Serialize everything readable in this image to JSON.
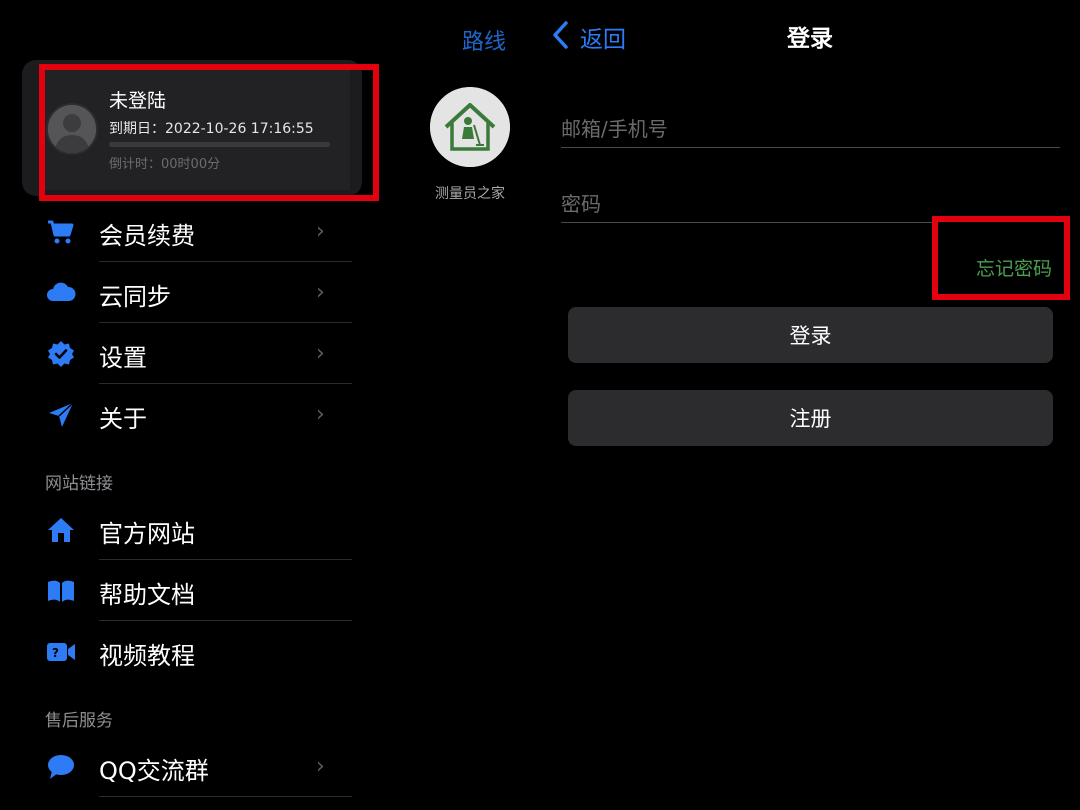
{
  "profile": {
    "name": "未登陆",
    "expiry": "到期日：2022-10-26 17:16:55",
    "countdown": "倒计时：00时00分"
  },
  "menu": {
    "items": [
      {
        "label": "会员续费",
        "icon": "cart-icon",
        "has_chevron": true
      },
      {
        "label": "云同步",
        "icon": "cloud-icon",
        "has_chevron": true
      },
      {
        "label": "设置",
        "icon": "badge-check-icon",
        "has_chevron": true
      },
      {
        "label": "关于",
        "icon": "paper-plane-icon",
        "has_chevron": true
      }
    ]
  },
  "website_section": {
    "title": "网站链接",
    "items": [
      {
        "label": "官方网站",
        "icon": "home-icon"
      },
      {
        "label": "帮助文档",
        "icon": "book-icon"
      },
      {
        "label": "视频教程",
        "icon": "video-icon"
      }
    ]
  },
  "service_section": {
    "title": "售后服务",
    "items": [
      {
        "label": "QQ交流群",
        "icon": "chat-bubble-icon",
        "has_chevron": true
      }
    ]
  },
  "middle": {
    "route_link": "路线",
    "app_name": "测量员之家"
  },
  "login": {
    "back_label": "返回",
    "title": "登录",
    "email_placeholder": "邮箱/手机号",
    "password_placeholder": "密码",
    "forgot_password": "忘记密码",
    "login_button": "登录",
    "register_button": "注册"
  },
  "colors": {
    "accent_blue": "#2d7cf6",
    "link_blue": "#1e66cc",
    "forgot_green": "#4aa04e",
    "highlight_red": "#e3000f",
    "background": "#000000",
    "button_bg": "#2c2c2e"
  }
}
